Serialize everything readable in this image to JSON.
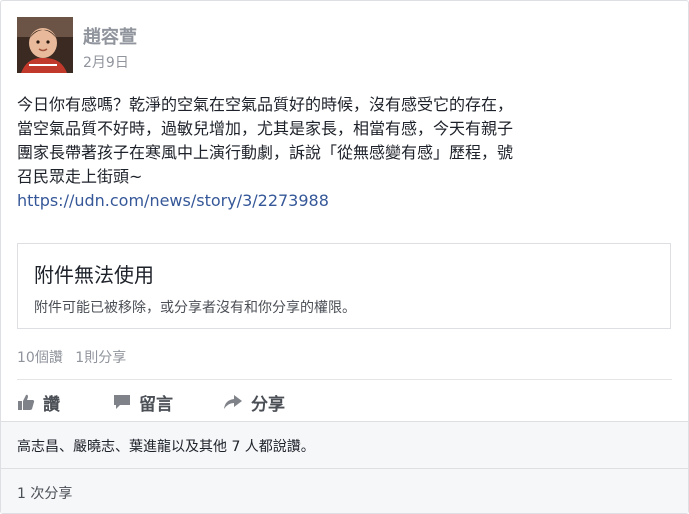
{
  "post": {
    "author": "趙容萱",
    "date": "2月9日",
    "text_lines": [
      "今日你有感嗎？乾淨的空氣在空氣品質好的時候，沒有感受它的存在，",
      "當空氣品質不好時，過敏兒增加，尤其是家長，相當有感，今天有親子",
      "團家長帶著孩子在寒風中上演行動劇，訴說「從無感變有感」歷程，號",
      "召民眾走上街頭~"
    ],
    "link": "https://udn.com/news/story/3/2273988"
  },
  "attachment": {
    "title": "附件無法使用",
    "description": "附件可能已被移除，或分享者沒有和你分享的權限。"
  },
  "stats": {
    "reads": "10個讚",
    "shares": "1則分享"
  },
  "actions": {
    "like": "讚",
    "comment": "留言",
    "share": "分享",
    "like_icon": "thumbs-up-icon",
    "comment_icon": "speech-bubble-icon",
    "share_icon": "share-arrow-icon"
  },
  "footer": {
    "likes_summary": "高志昌、嚴曉志、葉進龍以及其他 7 人都說讚。",
    "share_count": "1 次分享"
  },
  "colors": {
    "link": "#365899",
    "muted": "#90949c",
    "text": "#1d2129",
    "footer_bg": "#f6f7f9"
  }
}
